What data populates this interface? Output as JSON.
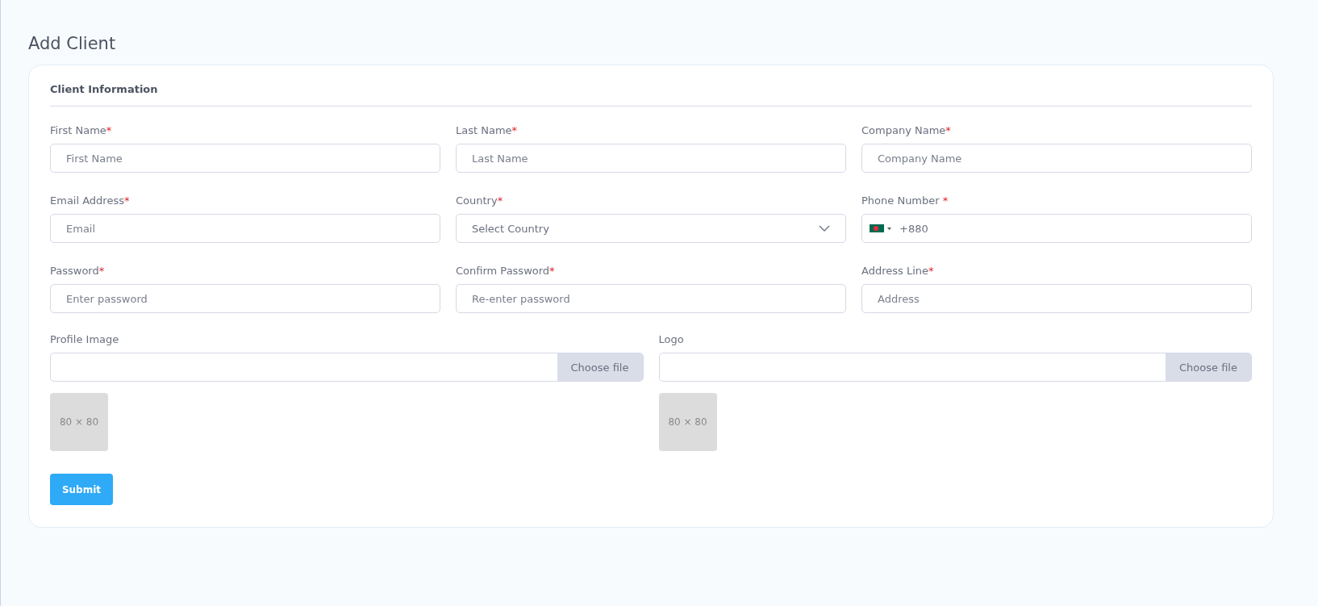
{
  "page_title": "Add Client",
  "section_title": "Client Information",
  "fields": [
    {
      "kind": "text",
      "label": "First Name",
      "mark": "*",
      "placeholder": "First Name"
    },
    {
      "kind": "text",
      "label": "Last Name",
      "mark": "*",
      "placeholder": "Last Name"
    },
    {
      "kind": "text",
      "label": "Company Name",
      "mark": "*",
      "placeholder": "Company Name"
    },
    {
      "kind": "text",
      "label": "Email Address",
      "mark": "*",
      "placeholder": "Email"
    },
    {
      "kind": "select",
      "label": "Country",
      "mark": "*",
      "placeholder": "Select Country"
    },
    {
      "kind": "phone",
      "label": "Phone Number",
      "mark": " *",
      "value": "+880"
    },
    {
      "kind": "text",
      "label": "Password",
      "mark": "*",
      "placeholder": "Enter password"
    },
    {
      "kind": "text",
      "label": "Confirm Password",
      "mark": "*",
      "placeholder": "Re-enter password"
    },
    {
      "kind": "text",
      "label": "Address Line",
      "mark": "*",
      "placeholder": "Address"
    }
  ],
  "uploads": [
    {
      "label": "Profile Image",
      "button": "Choose file",
      "preview": "80 × 80"
    },
    {
      "label": "Logo",
      "button": "Choose file",
      "preview": "80 × 80"
    }
  ],
  "submit": "Submit"
}
